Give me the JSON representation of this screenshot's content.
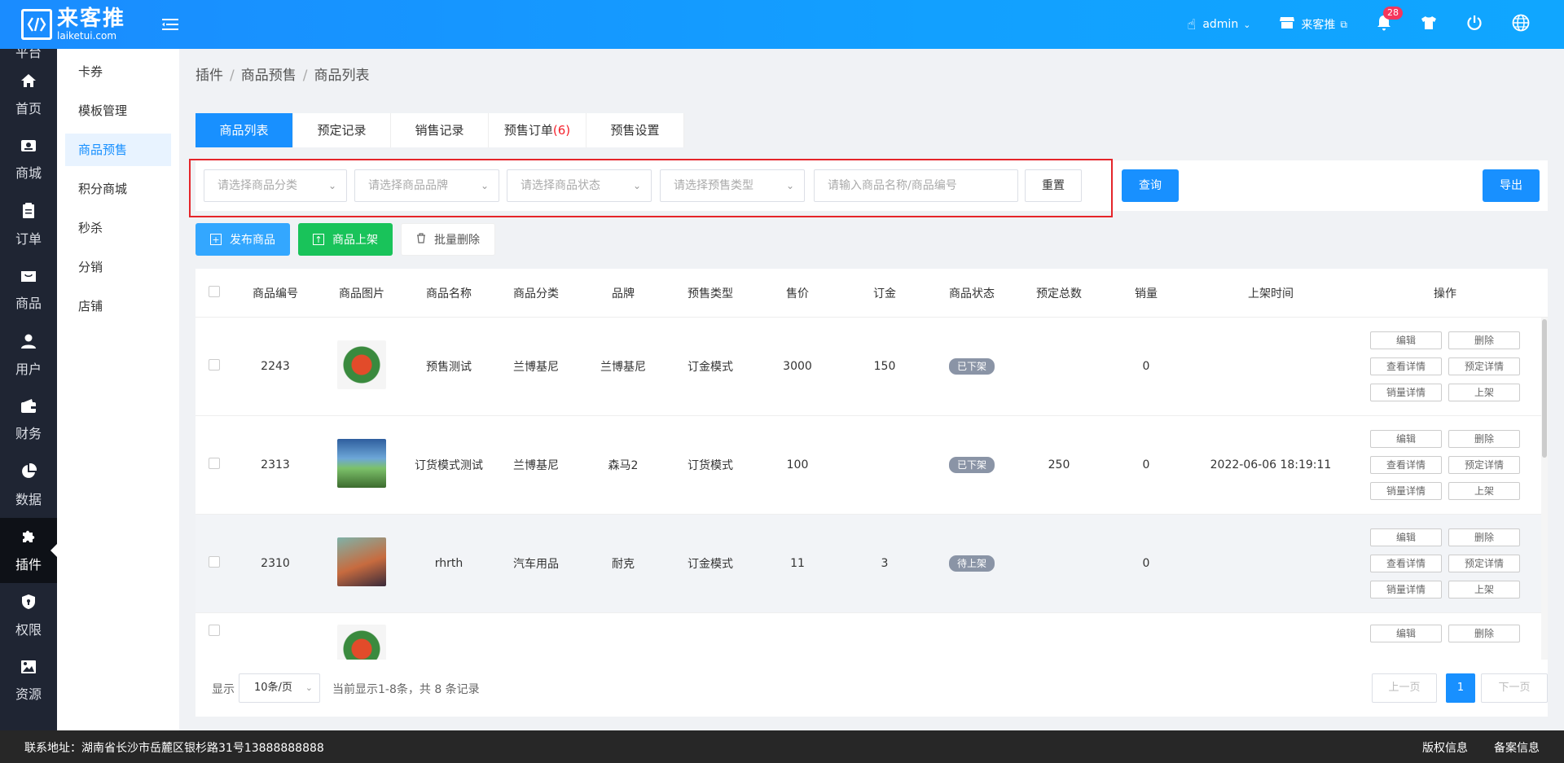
{
  "header": {
    "logo_main": "来客推",
    "logo_sub": "laiketui.com",
    "user": "admin",
    "store": "来客推",
    "notifications": "28"
  },
  "nav": {
    "top_partial": "平台",
    "items": [
      {
        "label": "首页",
        "icon": "home-icon"
      },
      {
        "label": "商城",
        "icon": "mall-icon"
      },
      {
        "label": "订单",
        "icon": "order-icon"
      },
      {
        "label": "商品",
        "icon": "product-icon"
      },
      {
        "label": "用户",
        "icon": "user-icon"
      },
      {
        "label": "财务",
        "icon": "wallet-icon"
      },
      {
        "label": "数据",
        "icon": "chart-icon"
      },
      {
        "label": "插件",
        "icon": "puzzle-icon"
      },
      {
        "label": "权限",
        "icon": "shield-icon"
      },
      {
        "label": "资源",
        "icon": "image-icon"
      }
    ],
    "active_index": 7
  },
  "subnav": {
    "items": [
      "卡券",
      "模板管理",
      "商品预售",
      "积分商城",
      "秒杀",
      "分销",
      "店铺"
    ],
    "active_index": 2
  },
  "breadcrumb": [
    "插件",
    "商品预售",
    "商品列表"
  ],
  "tabs": [
    {
      "label": "商品列表",
      "count": ""
    },
    {
      "label": "预定记录",
      "count": ""
    },
    {
      "label": "销售记录",
      "count": ""
    },
    {
      "label": "预售订单",
      "count": "(6)"
    },
    {
      "label": "预售设置",
      "count": ""
    }
  ],
  "filters": {
    "category_placeholder": "请选择商品分类",
    "brand_placeholder": "请选择商品品牌",
    "status_placeholder": "请选择商品状态",
    "presale_type_placeholder": "请选择预售类型",
    "keyword_placeholder": "请输入商品名称/商品编号",
    "reset_label": "重置",
    "query_label": "查询",
    "export_label": "导出"
  },
  "actions": {
    "publish_label": "发布商品",
    "shelve_label": "商品上架",
    "batch_delete_label": "批量删除"
  },
  "table": {
    "columns": [
      "商品编号",
      "商品图片",
      "商品名称",
      "商品分类",
      "品牌",
      "预售类型",
      "售价",
      "订金",
      "商品状态",
      "预定总数",
      "销量",
      "上架时间",
      "操作"
    ],
    "rows": [
      {
        "id": "2243",
        "name": "预售测试",
        "category": "兰博基尼",
        "brand": "兰博基尼",
        "type": "订金模式",
        "price": "3000",
        "deposit": "150",
        "status": "已下架",
        "reserved": "",
        "sales": "0",
        "time": "",
        "ops": [
          "编辑",
          "删除",
          "查看详情",
          "预定详情",
          "销量详情",
          "上架"
        ]
      },
      {
        "id": "2313",
        "name": "订货模式测试",
        "category": "兰博基尼",
        "brand": "森马2",
        "type": "订货模式",
        "price": "100",
        "deposit": "",
        "status": "已下架",
        "reserved": "250",
        "sales": "0",
        "time": "2022-06-06 18:19:11",
        "ops": [
          "编辑",
          "删除",
          "查看详情",
          "预定详情",
          "销量详情",
          "上架"
        ]
      },
      {
        "id": "2310",
        "name": "rhrth",
        "category": "汽车用品",
        "brand": "耐克",
        "type": "订金模式",
        "price": "11",
        "deposit": "3",
        "status": "待上架",
        "reserved": "",
        "sales": "0",
        "time": "",
        "ops": [
          "编辑",
          "删除",
          "查看详情",
          "预定详情",
          "销量详情",
          "上架"
        ]
      },
      {
        "id": "",
        "name": "",
        "category": "",
        "brand": "",
        "type": "",
        "price": "",
        "deposit": "",
        "status": "",
        "reserved": "",
        "sales": "",
        "time": "",
        "ops": [
          "编辑",
          "删除"
        ]
      }
    ]
  },
  "pager": {
    "show_label": "显示",
    "page_size": "10条/页",
    "info": "当前显示1-8条，共 8 条记录",
    "prev_label": "上一页",
    "current_page": "1",
    "next_label": "下一页"
  },
  "footer": {
    "address": "联系地址：湖南省长沙市岳麓区银杉路31号13888888888",
    "copyright_label": "版权信息",
    "icp_label": "备案信息"
  },
  "colors": {
    "primary": "#1890ff",
    "green": "#19c35a",
    "nav_bg": "#1f2533",
    "highlight_border": "#e5252a"
  }
}
